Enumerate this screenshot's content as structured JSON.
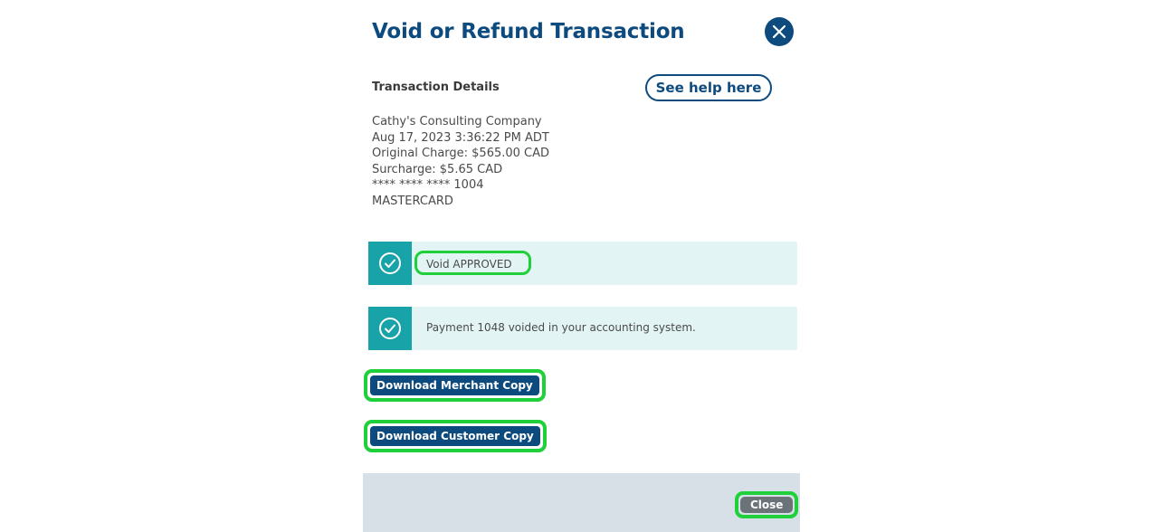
{
  "modal": {
    "title": "Void or Refund Transaction",
    "close_icon": "close-x-icon"
  },
  "section": {
    "label": "Transaction Details",
    "help_button": "See help here"
  },
  "details": {
    "company": "Cathy's Consulting Company",
    "datetime": "Aug 17, 2023 3:36:22 PM ADT",
    "original_charge": "Original Charge: $565.00 CAD",
    "surcharge": "Surcharge: $5.65 CAD",
    "card_number": "**** **** **** 1004",
    "card_type": "MASTERCARD"
  },
  "alerts": [
    {
      "icon": "check-circle-icon",
      "message": "Void APPROVED"
    },
    {
      "icon": "check-circle-icon",
      "message": "Payment 1048 voided in your accounting system."
    }
  ],
  "buttons": {
    "download_merchant": "Download Merchant Copy",
    "download_customer": "Download Customer Copy",
    "close": "Close"
  },
  "colors": {
    "primary": "#0d4a7e",
    "teal": "#17a3a8",
    "alert_bg": "#e3f4f4",
    "highlight": "#1fd03a",
    "footer_bg": "#d7e0e6"
  }
}
